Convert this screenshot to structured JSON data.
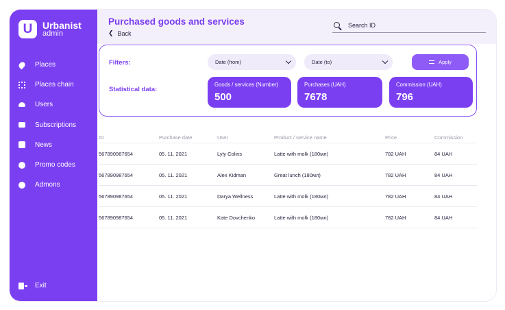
{
  "app": {
    "logo_letter": "U",
    "logo_title": "Urbanist",
    "logo_sub": "admin"
  },
  "sidebar": {
    "items": [
      {
        "label": "Places",
        "icon": "pin-icon"
      },
      {
        "label": "Places chain",
        "icon": "chain-icon"
      },
      {
        "label": "Users",
        "icon": "users-icon"
      },
      {
        "label": "Subscriptions",
        "icon": "card-icon"
      },
      {
        "label": "News",
        "icon": "news-icon"
      },
      {
        "label": "Promo codes",
        "icon": "badge-icon"
      },
      {
        "label": "Admons",
        "icon": "coin-icon"
      }
    ],
    "exit_label": "Exit"
  },
  "header": {
    "title": "Purchased goods and services",
    "back_label": "Back",
    "search_placeholder": "Search ID"
  },
  "filters": {
    "label": "Filters:",
    "date_from": "Date (from)",
    "date_to": "Date (to)",
    "apply_label": "Apply"
  },
  "stats": {
    "label": "Statistical data:",
    "cards": [
      {
        "title": "Goods / services (Number)",
        "value": "500"
      },
      {
        "title": "Purchases (UAH)",
        "value": "7678"
      },
      {
        "title": "Commission (UAH)",
        "value": "796"
      }
    ]
  },
  "table": {
    "columns": [
      "ID",
      "Purchase date",
      "User",
      "Product / service name",
      "Price",
      "Commission"
    ],
    "rows": [
      [
        "567890987654",
        "05. 11. 2021",
        "Lyly Colins",
        "Latte with molk (180мл)",
        "782 UAH",
        "84 UAH"
      ],
      [
        "567890987654",
        "05. 11. 2021",
        "Alex Kidman",
        "Great lunch (180мл)",
        "782 UAH",
        "84 UAH"
      ],
      [
        "567890987654",
        "05. 11. 2021",
        "Darya Wellness",
        "Latte with molk (180мл)",
        "782 UAH",
        "84 UAH"
      ],
      [
        "567890987654",
        "05. 11. 2021",
        "Kate Dovchenko",
        "Latte with molk (180мл)",
        "782 UAH",
        "84 UAH"
      ]
    ]
  },
  "colors": {
    "accent": "#7b3ff2",
    "header_bg": "#f4f0fb"
  }
}
